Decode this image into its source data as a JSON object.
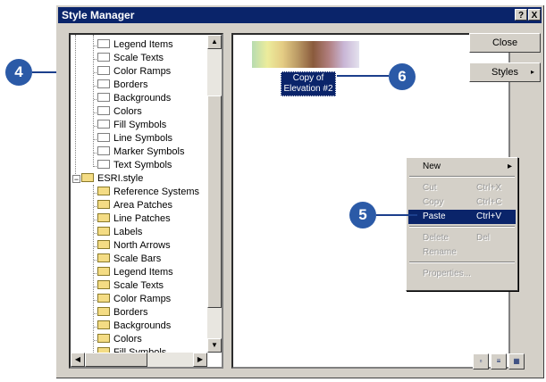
{
  "window": {
    "title": "Style Manager",
    "help_label": "?",
    "close_label": "X"
  },
  "tree": {
    "group1_items": [
      "Legend Items",
      "Scale Texts",
      "Color Ramps",
      "Borders",
      "Backgrounds",
      "Colors",
      "Fill Symbols",
      "Line Symbols",
      "Marker Symbols",
      "Text Symbols"
    ],
    "esri_style": {
      "expander": "−",
      "label": "ESRI.style"
    },
    "esri_items": [
      "Reference Systems",
      "Area Patches",
      "Line Patches",
      "Labels",
      "North Arrows",
      "Scale Bars",
      "Legend Items",
      "Scale Texts",
      "Color Ramps",
      "Borders",
      "Backgrounds",
      "Colors",
      "Fill Symbols"
    ]
  },
  "content": {
    "item_label_line1": "Copy of",
    "item_label_line2": "Elevation #2"
  },
  "buttons": {
    "close": "Close",
    "styles": "Styles"
  },
  "context_menu": {
    "items": [
      {
        "label": "New",
        "key": "",
        "state": "normal",
        "arrow": "▸"
      },
      {
        "label": "Cut",
        "key": "Ctrl+X",
        "state": "disabled"
      },
      {
        "label": "Copy",
        "key": "Ctrl+C",
        "state": "disabled"
      },
      {
        "label": "Paste",
        "key": "Ctrl+V",
        "state": "selected"
      },
      {
        "label": "Delete",
        "key": "Del",
        "state": "disabled"
      },
      {
        "label": "Rename",
        "key": "",
        "state": "disabled"
      },
      {
        "label": "Properties...",
        "key": "",
        "state": "disabled"
      }
    ]
  },
  "callouts": {
    "c4": "4",
    "c5": "5",
    "c6": "6"
  },
  "colors": {
    "title_bar": "#0a246a",
    "selection": "#0a246a",
    "callout": "#2b5aa7"
  }
}
